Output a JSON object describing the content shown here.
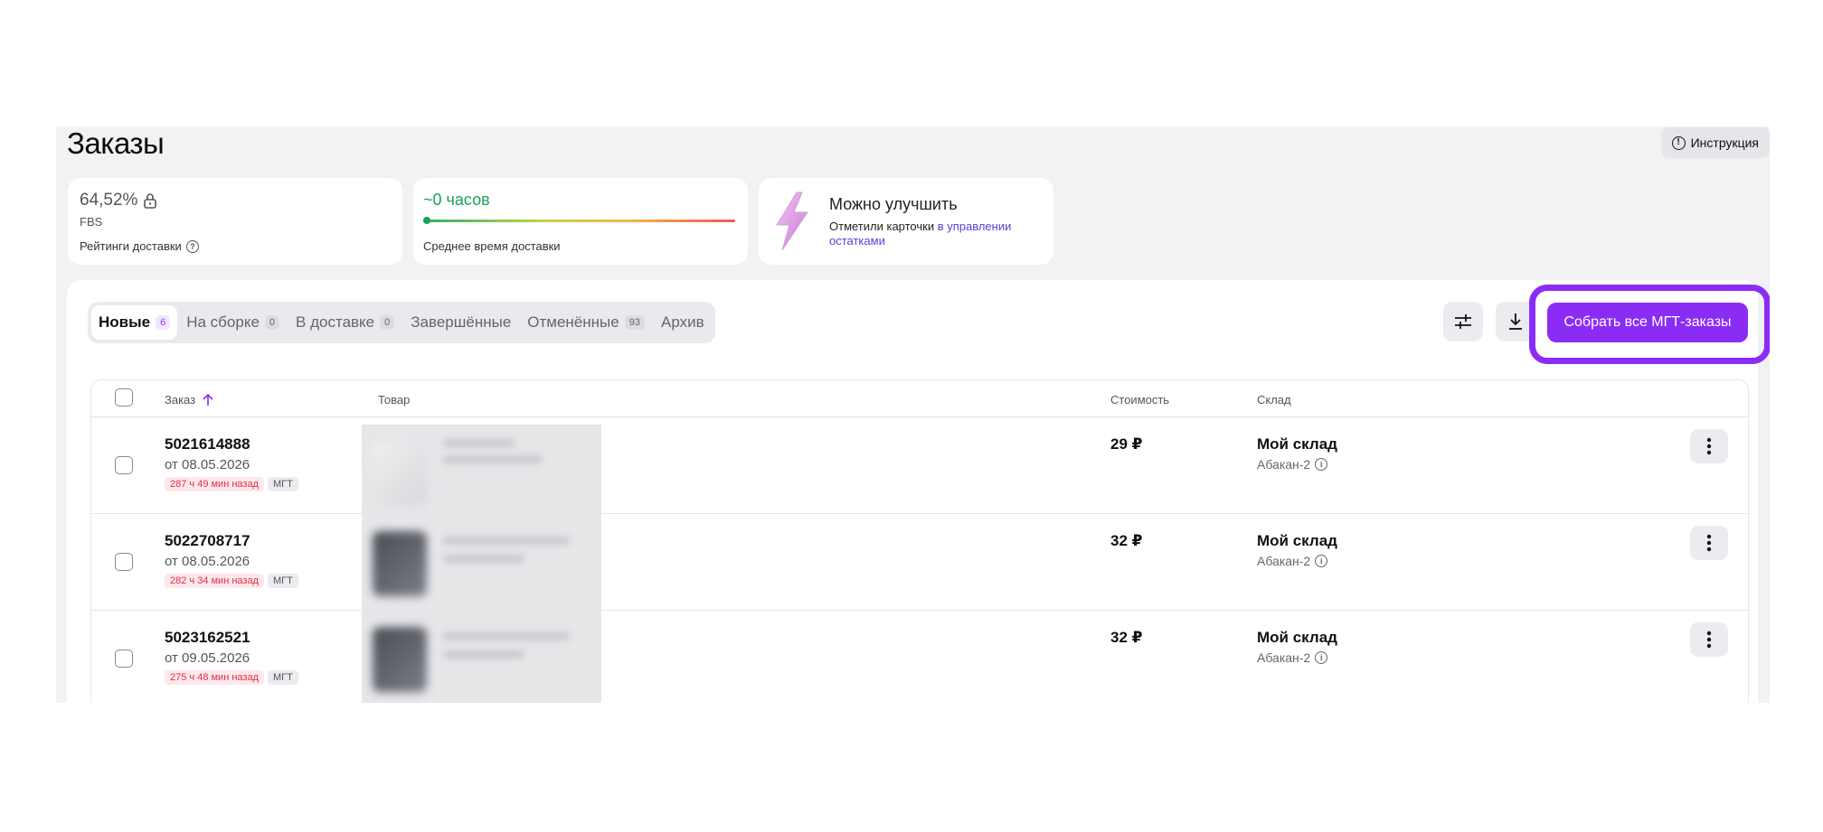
{
  "page": {
    "title": "Заказы"
  },
  "header": {
    "instruction_label": "Инструкция"
  },
  "stats": {
    "rating": {
      "value": "64,52%",
      "sub": "FBS",
      "footer": "Рейтинги доставки"
    },
    "delivery": {
      "value": "~0 часов",
      "footer": "Среднее время доставки"
    },
    "improve": {
      "title": "Можно улучшить",
      "text": "Отметили карточки ",
      "link": "в управлении остатками"
    }
  },
  "tabs": [
    {
      "label": "Новые",
      "count": "6"
    },
    {
      "label": "На сборке",
      "count": "0"
    },
    {
      "label": "В доставке",
      "count": "0"
    },
    {
      "label": "Завершённые",
      "count": ""
    },
    {
      "label": "Отменённые",
      "count": "93"
    },
    {
      "label": "Архив",
      "count": ""
    }
  ],
  "toolbar": {
    "collect_label": "Собрать все МГТ-заказы"
  },
  "table": {
    "columns": {
      "order": "Заказ",
      "product": "Товар",
      "price": "Стоимость",
      "warehouse": "Склад"
    },
    "rows": [
      {
        "number": "5021614888",
        "date": "от 08.05.2026",
        "time_tag": "287 ч 49 мин назад",
        "type_tag": "МГТ",
        "price": "29 ₽",
        "warehouse": "Мой склад",
        "city": "Абакан-2"
      },
      {
        "number": "5022708717",
        "date": "от 08.05.2026",
        "time_tag": "282 ч 34 мин назад",
        "type_tag": "МГТ",
        "price": "32 ₽",
        "warehouse": "Мой склад",
        "city": "Абакан-2"
      },
      {
        "number": "5023162521",
        "date": "от 09.05.2026",
        "time_tag": "275 ч 48 мин назад",
        "type_tag": "МГТ",
        "price": "32 ₽",
        "warehouse": "Мой склад",
        "city": "Абакан-2"
      }
    ]
  },
  "colors": {
    "accent": "#8b2cf5",
    "green": "#1aa157",
    "danger": "#e0304a"
  }
}
